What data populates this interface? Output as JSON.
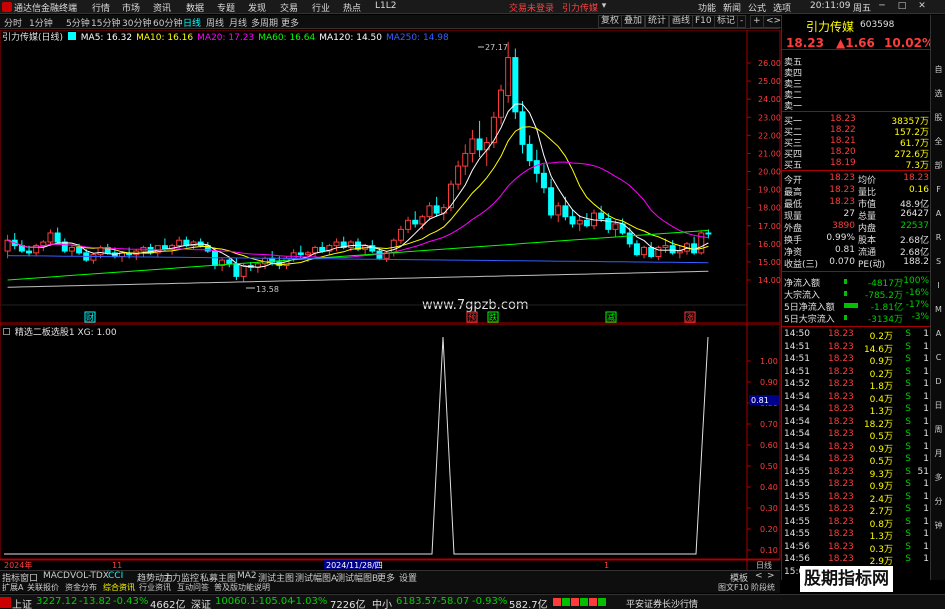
{
  "titlebar": {
    "app_name": "通达信金融终端",
    "menu": [
      "行情",
      "市场",
      "资讯",
      "数据",
      "专题",
      "发现",
      "交易",
      "行业",
      "热点",
      "L1L2"
    ],
    "trade_label": "交易未登录",
    "stock_label": "引力传媒",
    "right_menu": [
      "功能",
      "新闻",
      "公式",
      "选项"
    ],
    "time": "20:11:09",
    "day": "周五"
  },
  "toolbar": {
    "periods": [
      "分时",
      "1分钟",
      "5分钟",
      "15分钟",
      "30分钟",
      "60分钟",
      "日线",
      "周线",
      "月线",
      "多周期",
      "更多"
    ],
    "active": "日线",
    "right_buttons": [
      "复权",
      "叠加",
      "统计",
      "画线",
      "F10",
      "标记",
      "-",
      "+",
      "<>"
    ]
  },
  "main_legend": {
    "title": "引力传媒(日线)",
    "ma": [
      {
        "label": "MA5: 16.32",
        "color": "#ffffff"
      },
      {
        "label": "MA10: 16.16",
        "color": "#ffff00"
      },
      {
        "label": "MA20: 17.23",
        "color": "#ff00ff"
      },
      {
        "label": "MA60: 16.64",
        "color": "#00ff00"
      },
      {
        "label": "MA120: 14.50",
        "color": "#ffffff"
      },
      {
        "label": "MA250: 14.98",
        "color": "#3060ff"
      }
    ]
  },
  "main_axis": {
    "ticks": [
      "26.00",
      "25.00",
      "24.00",
      "23.00",
      "22.00",
      "21.00",
      "20.00",
      "19.00",
      "18.00",
      "17.00",
      "16.00",
      "15.00",
      "14.00"
    ],
    "high_label": "27.17",
    "low_label": "13.58",
    "watermark": "www.7gpzb.com",
    "event_marks": [
      "财",
      "预",
      "跌",
      "减",
      "涨"
    ]
  },
  "sub_legend": {
    "title": "精选二板选股1",
    "value": "XG: 1.00"
  },
  "sub_axis": {
    "ticks": [
      "1.00",
      "0.90",
      "0.80",
      "0.70",
      "0.60",
      "0.50",
      "0.40",
      "0.30",
      "0.20",
      "0.10"
    ],
    "current": "0.81"
  },
  "xaxis": {
    "labels": [
      "2024年",
      "11",
      "2024/11/28/四",
      "1"
    ],
    "right_label": "日线"
  },
  "quote": {
    "name": "引力传媒",
    "code": "603598",
    "price": "18.23",
    "change": "▲1.66",
    "change_pct": "10.02%",
    "sell": [
      {
        "label": "卖五",
        "price": "",
        "vol": ""
      },
      {
        "label": "卖四",
        "price": "",
        "vol": ""
      },
      {
        "label": "卖三",
        "price": "",
        "vol": ""
      },
      {
        "label": "卖二",
        "price": "",
        "vol": ""
      },
      {
        "label": "卖一",
        "price": "",
        "vol": ""
      }
    ],
    "buy": [
      {
        "label": "买一",
        "price": "18.23",
        "vol": "38357万"
      },
      {
        "label": "买二",
        "price": "18.22",
        "vol": "157.2万"
      },
      {
        "label": "买三",
        "price": "18.21",
        "vol": "61.7万"
      },
      {
        "label": "买四",
        "price": "18.20",
        "vol": "272.6万"
      },
      {
        "label": "买五",
        "price": "18.19",
        "vol": "7.3万"
      }
    ],
    "stats": [
      {
        "l1": "今开",
        "v1": "18.23",
        "l2": "均价",
        "v2": "18.23",
        "c1": "red",
        "c2": "red"
      },
      {
        "l1": "最高",
        "v1": "18.23",
        "l2": "量比",
        "v2": "0.16",
        "c1": "red",
        "c2": "yellow"
      },
      {
        "l1": "最低",
        "v1": "18.23",
        "l2": "市值",
        "v2": "48.9亿",
        "c1": "red",
        "c2": "white"
      },
      {
        "l1": "现量",
        "v1": "27",
        "l2": "总量",
        "v2": "26427",
        "c1": "white",
        "c2": "white"
      },
      {
        "l1": "外盘",
        "v1": "3890",
        "l2": "内盘",
        "v2": "22537",
        "c1": "red",
        "c2": "green"
      },
      {
        "l1": "换手",
        "v1": "0.99%",
        "l2": "股本",
        "v2": "2.68亿",
        "c1": "white",
        "c2": "white"
      },
      {
        "l1": "净资",
        "v1": "0.81",
        "l2": "流通",
        "v2": "2.68亿",
        "c1": "white",
        "c2": "white"
      },
      {
        "l1": "收益(三)",
        "v1": "0.070",
        "l2": "PE(动)",
        "v2": "188.2",
        "c1": "white",
        "c2": "white"
      }
    ],
    "flows": [
      {
        "label": "净流入额",
        "value": "-4817万",
        "pct": "-100%"
      },
      {
        "label": "大宗流入",
        "value": "-785.2万",
        "pct": "-16%"
      },
      {
        "label": "5日净流入额",
        "value": "-1.81亿",
        "pct": "-17%"
      },
      {
        "label": "5日大宗流入",
        "value": "-3134万",
        "pct": "-3%"
      }
    ],
    "ticks": [
      {
        "time": "14:50",
        "price": "18.23",
        "vol": "0.2万",
        "bs": "S",
        "n": "1"
      },
      {
        "time": "14:51",
        "price": "18.23",
        "vol": "14.6万",
        "bs": "S",
        "n": "1"
      },
      {
        "time": "14:51",
        "price": "18.23",
        "vol": "0.9万",
        "bs": "S",
        "n": "1"
      },
      {
        "time": "14:51",
        "price": "18.23",
        "vol": "0.2万",
        "bs": "S",
        "n": "1"
      },
      {
        "time": "14:52",
        "price": "18.23",
        "vol": "1.8万",
        "bs": "S",
        "n": "1"
      },
      {
        "time": "14:54",
        "price": "18.23",
        "vol": "0.4万",
        "bs": "S",
        "n": "1"
      },
      {
        "time": "14:54",
        "price": "18.23",
        "vol": "1.3万",
        "bs": "S",
        "n": "1"
      },
      {
        "time": "14:54",
        "price": "18.23",
        "vol": "18.2万",
        "bs": "S",
        "n": "1"
      },
      {
        "time": "14:54",
        "price": "18.23",
        "vol": "0.5万",
        "bs": "S",
        "n": "1"
      },
      {
        "time": "14:54",
        "price": "18.23",
        "vol": "0.9万",
        "bs": "S",
        "n": "1"
      },
      {
        "time": "14:54",
        "price": "18.23",
        "vol": "0.5万",
        "bs": "S",
        "n": "1"
      },
      {
        "time": "14:55",
        "price": "18.23",
        "vol": "9.3万",
        "bs": "S",
        "n": "51"
      },
      {
        "time": "14:55",
        "price": "18.23",
        "vol": "0.9万",
        "bs": "S",
        "n": "1"
      },
      {
        "time": "14:55",
        "price": "18.23",
        "vol": "2.4万",
        "bs": "S",
        "n": "1"
      },
      {
        "time": "14:55",
        "price": "18.23",
        "vol": "2.7万",
        "bs": "S",
        "n": "1"
      },
      {
        "time": "14:55",
        "price": "18.23",
        "vol": "0.8万",
        "bs": "S",
        "n": "1"
      },
      {
        "time": "14:55",
        "price": "18.23",
        "vol": "1.3万",
        "bs": "S",
        "n": "1"
      },
      {
        "time": "14:56",
        "price": "18.23",
        "vol": "0.3万",
        "bs": "S",
        "n": "1"
      },
      {
        "time": "14:56",
        "price": "18.23",
        "vol": "2.9万",
        "bs": "S",
        "n": "1"
      }
    ],
    "bottom_label": "15:0"
  },
  "sidetabs": [
    "自",
    "选",
    "股",
    "全",
    "部",
    "F",
    "A",
    "R",
    "S",
    "I",
    "M",
    "A",
    "C",
    "D",
    "日",
    "周",
    "月",
    "多",
    "分",
    "钟"
  ],
  "bottomtabs": [
    "指标",
    "窗口",
    "MACD",
    "VOL-TDX",
    "CCI",
    "趋势动力",
    "主力监控",
    "私募主图",
    "MA2",
    "测试主图",
    "测试幅图A",
    "测试幅图B",
    "更多",
    "设置"
  ],
  "bottomtabs_right": [
    "模板",
    "<",
    ">"
  ],
  "bottomtabs2": [
    "扩展A",
    "关联报价",
    "资金分布",
    "综合资讯",
    "行业资讯",
    "互动问答",
    "普及版功能说明"
  ],
  "bottomtabs2_right": [
    "图文F10",
    "阶段统计"
  ],
  "statusbar": {
    "items": [
      {
        "label": "上证",
        "value": "3227.12",
        "chg": "-13.82",
        "pct": "-0.43%",
        "amt": "4662亿"
      },
      {
        "label": "深证",
        "value": "10060.1",
        "chg": "-105.04",
        "pct": "-1.03%",
        "amt": "7226亿"
      },
      {
        "label": "中小",
        "value": "6183.57",
        "chg": "-58.07",
        "pct": "-0.93%",
        "amt": "582.7亿"
      }
    ],
    "broker": "平安证券长沙行情"
  },
  "site_watermark": "股期指标网",
  "colors": {
    "up": "#ff3c3c",
    "down": "#00ffff",
    "flat": "#ffffff",
    "border": "#aa0000",
    "accent_cyan": "#00ffff"
  }
}
